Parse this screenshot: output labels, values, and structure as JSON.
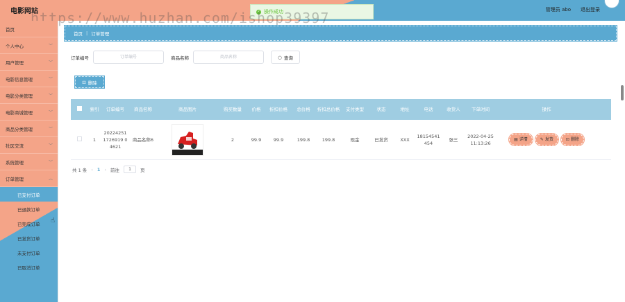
{
  "header": {
    "app_title": "电影网站",
    "toast": "操作成功",
    "admin": "管理员 abo",
    "logout": "退出登录",
    "watermark": "https://www.huzhan.com/ishop39397"
  },
  "sidebar": {
    "items": [
      {
        "label": "首页"
      },
      {
        "label": "个人中心"
      },
      {
        "label": "用户管理"
      },
      {
        "label": "电影信息管理"
      },
      {
        "label": "电影分类管理"
      },
      {
        "label": "电影商城管理"
      },
      {
        "label": "商品分类管理"
      },
      {
        "label": "社区交流"
      },
      {
        "label": "系统管理"
      },
      {
        "label": "订单管理"
      }
    ],
    "sub_items": [
      {
        "label": "已支付订单"
      },
      {
        "label": "已退款订单"
      },
      {
        "label": "已完成订单"
      },
      {
        "label": "已发货订单"
      },
      {
        "label": "未支付订单"
      },
      {
        "label": "已取消订单"
      }
    ]
  },
  "breadcrumb": {
    "home": "首页",
    "current": "订单管理"
  },
  "search": {
    "order_no_label": "订单编号",
    "order_no_placeholder": "订单编号",
    "goods_name_label": "商品名称",
    "goods_name_placeholder": "商品名称",
    "query_button": "查询"
  },
  "toolbar": {
    "delete_button": "删除"
  },
  "table": {
    "columns": [
      "索引",
      "订单编号",
      "商品名称",
      "商品图片",
      "购买数量",
      "价格",
      "折扣价格",
      "总价格",
      "折扣总价格",
      "支付类型",
      "状态",
      "地址",
      "电话",
      "收货人",
      "下单时间",
      "操作"
    ],
    "rows": [
      {
        "index": "1",
        "order_no": "202242511726919 04621",
        "goods_name": "商品名称6",
        "qty": "2",
        "price": "99.9",
        "discount_price": "99.9",
        "total": "199.8",
        "discount_total": "199.8",
        "pay_type": "现金",
        "status": "已发货",
        "address": "XXX",
        "phone": "18154541454",
        "receiver": "张三",
        "order_time": "2022-04-25 11:13:26",
        "actions": {
          "detail": "详情",
          "ship": "发货",
          "delete": "删除"
        }
      }
    ]
  },
  "pagination": {
    "total": "共 1 条",
    "current_page": "1",
    "goto_label": "前往",
    "goto_value": "1",
    "page_unit": "页"
  }
}
